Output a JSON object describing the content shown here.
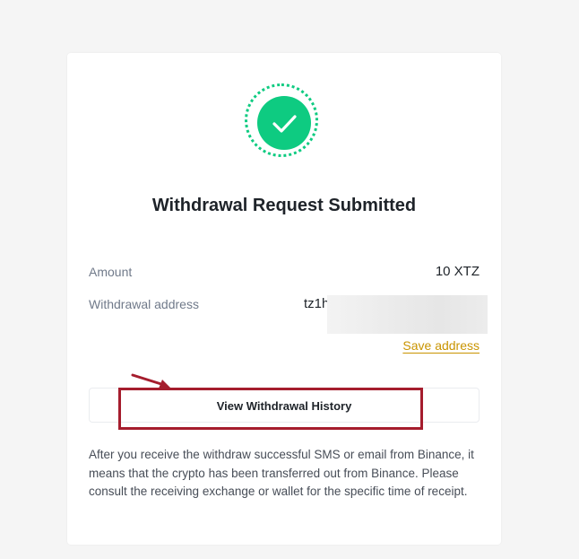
{
  "dialog": {
    "title": "Withdrawal Request Submitted",
    "amount_label": "Amount",
    "amount_value": "10 XTZ",
    "address_label": "Withdrawal address",
    "address_value_visible": "tz1h",
    "save_address_label": "Save address",
    "history_button_label": "View Withdrawal History",
    "note": "After you receive the withdraw successful SMS or email from Binance, it means that the crypto has been transferred out from Binance. Please consult the receiving exchange or wallet for the specific time of receipt."
  },
  "icons": {
    "status": "check-circle-icon",
    "annotation": "arrow-icon"
  },
  "colors": {
    "success": "#0ecb81",
    "link": "#c99400",
    "highlight": "#a51d2d",
    "text_primary": "#1e2329",
    "text_secondary": "#707a8a"
  }
}
